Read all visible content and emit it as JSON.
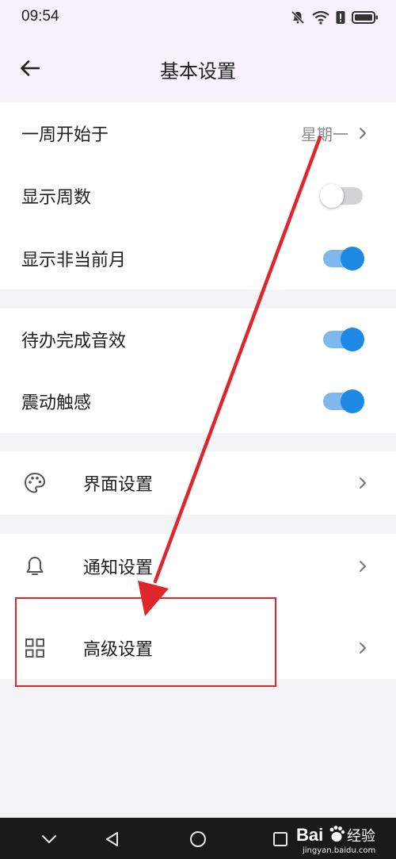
{
  "status_bar": {
    "time": "09:54",
    "icons": [
      "bell-off-icon",
      "wifi-icon",
      "alert-icon",
      "battery-icon"
    ]
  },
  "header": {
    "title": "基本设置",
    "back_icon": "arrow-left-icon"
  },
  "groups": [
    {
      "items": [
        {
          "label": "一周开始于",
          "value": "星期一",
          "control": "chevron"
        },
        {
          "label": "显示周数",
          "control": "toggle",
          "on": false
        },
        {
          "label": "显示非当前月",
          "control": "toggle",
          "on": true
        }
      ]
    },
    {
      "items": [
        {
          "label": "待办完成音效",
          "control": "toggle",
          "on": true
        },
        {
          "label": "震动触感",
          "control": "toggle",
          "on": true
        }
      ]
    },
    {
      "items": [
        {
          "label": "界面设置",
          "icon": "palette-icon",
          "control": "chevron"
        }
      ]
    },
    {
      "items": [
        {
          "label": "通知设置",
          "icon": "bell-icon",
          "control": "chevron"
        },
        {
          "label": "高级设置",
          "icon": "grid-icon",
          "control": "chevron"
        }
      ]
    }
  ],
  "colors": {
    "accent": "#1e88e5",
    "toggle_track_on": "#7fb8ee",
    "annotation": "#e0262d",
    "background": "#f4f3f6"
  },
  "nav_bar": {
    "buttons": [
      "chevron-down-icon",
      "triangle-back-icon",
      "circle-home-icon",
      "square-recents-icon"
    ]
  },
  "watermark": {
    "brand": "Bai",
    "brand_suffix": "经验",
    "url": "jingyan.baidu.com"
  }
}
